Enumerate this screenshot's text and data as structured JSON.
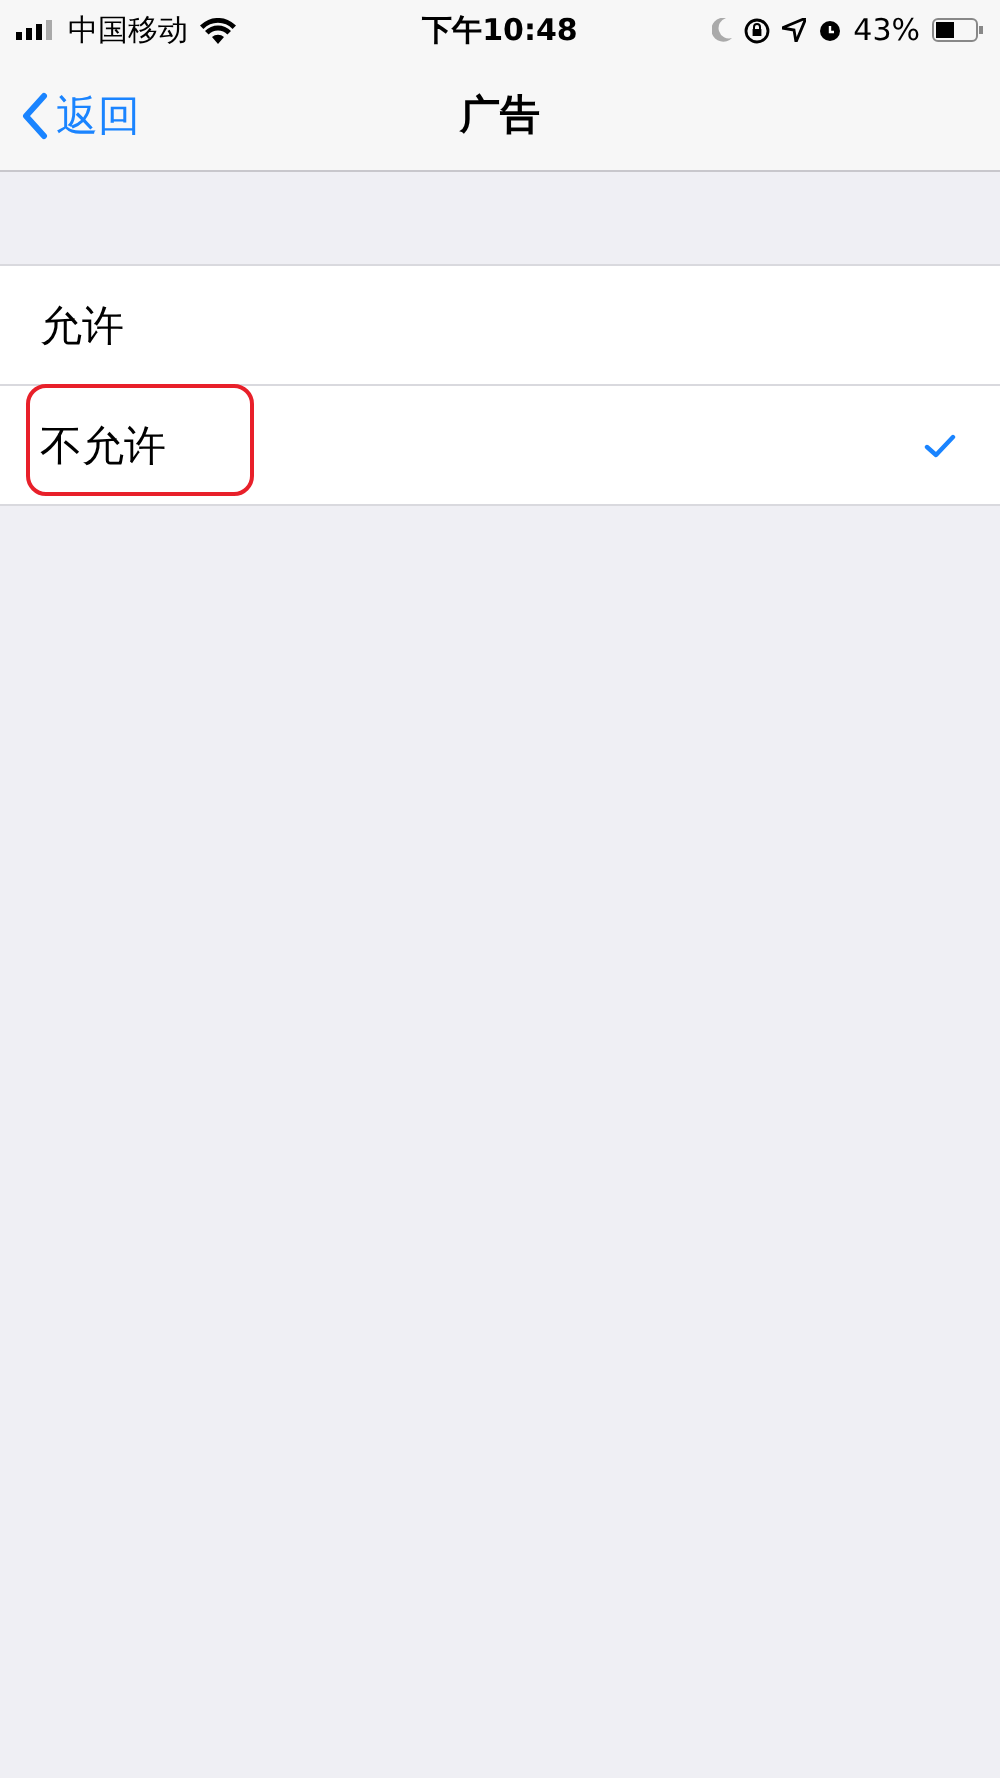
{
  "status_bar": {
    "carrier": "中国移动",
    "time": "下午10:48",
    "battery": "43%"
  },
  "nav_bar": {
    "back": "返回",
    "title": "广告"
  },
  "options": [
    {
      "label": "允许",
      "selected": false,
      "highlighted": false
    },
    {
      "label": "不允许",
      "selected": true,
      "highlighted": true
    }
  ]
}
